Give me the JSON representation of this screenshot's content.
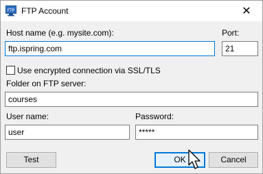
{
  "window": {
    "title": "FTP Account",
    "app_icon": "ftp-icon",
    "app_icon_text": "FTP",
    "close_symbol": "✕"
  },
  "form": {
    "host_label": "Host name (e.g. mysite.com):",
    "host_value": "ftp.ispring.com",
    "port_label": "Port:",
    "port_value": "21",
    "ssl_label": "Use encrypted connection via SSL/TLS",
    "ssl_checked": false,
    "folder_label": "Folder on FTP server:",
    "folder_value": "courses",
    "user_label": "User name:",
    "user_value": "user",
    "password_label": "Password:",
    "password_value": "*****"
  },
  "buttons": {
    "test": "Test",
    "ok": "OK",
    "cancel": "Cancel"
  },
  "colors": {
    "accent": "#0078d7",
    "dialog_bg": "#f0f0f0",
    "button_bg": "#e1e1e1"
  },
  "icons": [
    "ftp-icon",
    "close-icon",
    "checkbox-icon",
    "mouse-pointer-icon"
  ]
}
